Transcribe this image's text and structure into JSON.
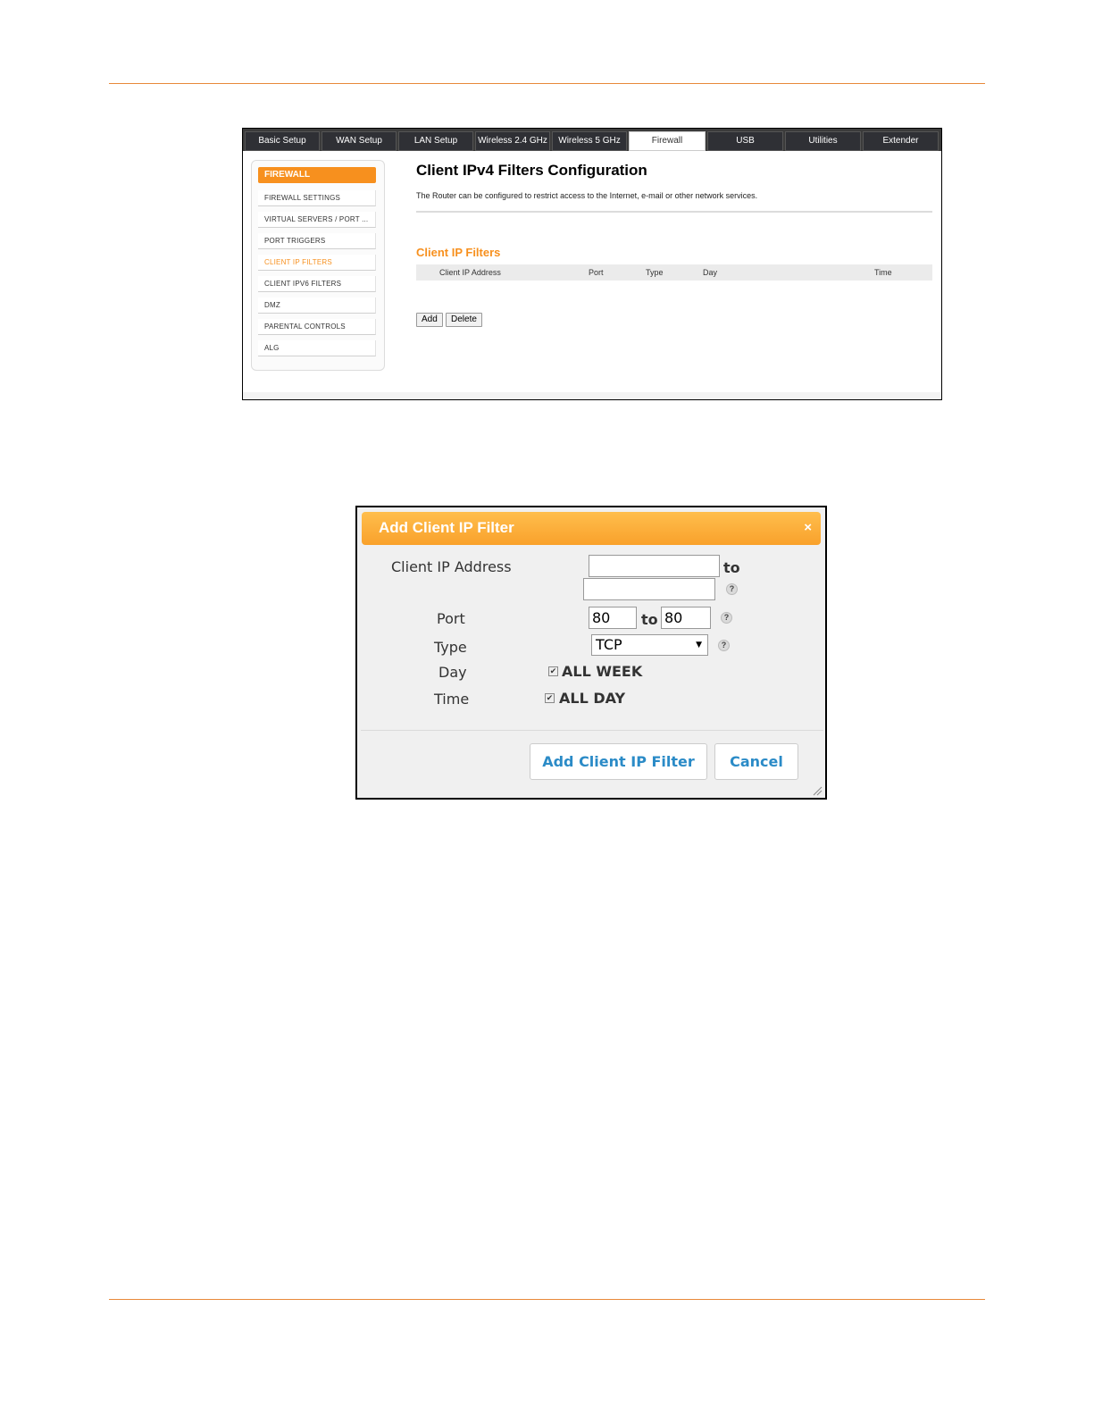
{
  "tabs": [
    "Basic Setup",
    "WAN Setup",
    "LAN Setup",
    "Wireless 2.4 GHz",
    "Wireless 5 GHz",
    "Firewall",
    "USB",
    "Utilities",
    "Extender"
  ],
  "sidebar": {
    "header": "FIREWALL",
    "items": [
      "FIREWALL SETTINGS",
      "VIRTUAL SERVERS / PORT ...",
      "PORT TRIGGERS",
      "CLIENT IP FILTERS",
      "CLIENT IPV6 FILTERS",
      "DMZ",
      "PARENTAL CONTROLS",
      "ALG"
    ],
    "active_item": "CLIENT IP FILTERS"
  },
  "main": {
    "title": "Client IPv4 Filters Configuration",
    "description": "The Router can be configured to restrict access to the Internet, e-mail or other network services.",
    "section_title": "Client IP Filters",
    "table_headers": [
      "Client IP Address",
      "Port",
      "Type",
      "Day",
      "Time"
    ],
    "add_label": "Add",
    "delete_label": "Delete"
  },
  "dialog": {
    "title": "Add Client IP Filter",
    "close": "×",
    "client_ip_label": "Client IP Address",
    "to_label": "to",
    "ip_start": "",
    "ip_end": "",
    "port_label": "Port",
    "port_start": "80",
    "port_end": "80",
    "type_label": "Type",
    "type_value": "TCP",
    "day_label": "Day",
    "day_value": "ALL WEEK",
    "time_label": "Time",
    "time_value": "ALL DAY",
    "help": "?",
    "submit_label": "Add Client IP Filter",
    "cancel_label": "Cancel"
  },
  "colors": {
    "accent": "#f7901e",
    "rule": "#e8893a",
    "button_text": "#2b8bc7"
  }
}
